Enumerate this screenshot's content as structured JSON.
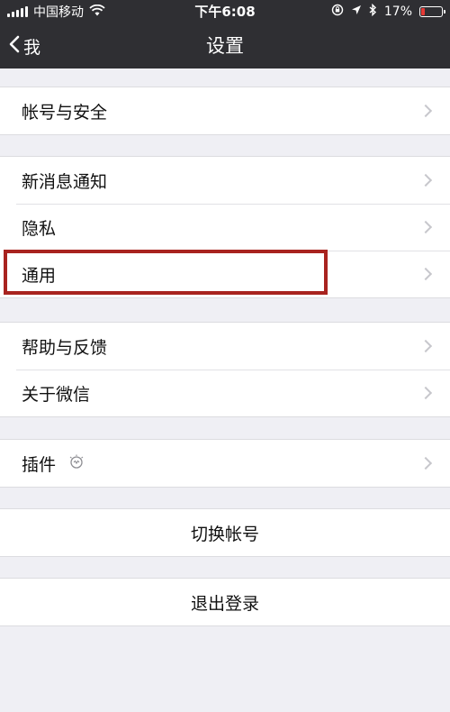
{
  "status_bar": {
    "carrier": "中国移动",
    "time": "下午6:08",
    "battery_percent": "17%",
    "battery_level": 0.17,
    "icons": [
      "signal-icon",
      "wifi-icon",
      "rotation-lock-icon",
      "location-icon",
      "bluetooth-icon",
      "battery-icon"
    ]
  },
  "nav": {
    "back_label": "我",
    "title": "设置"
  },
  "groups": [
    {
      "items": [
        {
          "label": "帐号与安全"
        }
      ]
    },
    {
      "items": [
        {
          "label": "新消息通知"
        },
        {
          "label": "隐私"
        },
        {
          "label": "通用"
        }
      ]
    },
    {
      "items": [
        {
          "label": "帮助与反馈"
        },
        {
          "label": "关于微信"
        }
      ]
    },
    {
      "items": [
        {
          "label": "插件",
          "icon": "lightbulb-icon"
        }
      ]
    }
  ],
  "actions": {
    "switch_account": "切换帐号",
    "logout": "退出登录"
  },
  "colors": {
    "bar_background": "#2f2f33",
    "page_background": "#efeff4",
    "highlight_border": "#a8231f",
    "battery_low": "#e53935"
  }
}
